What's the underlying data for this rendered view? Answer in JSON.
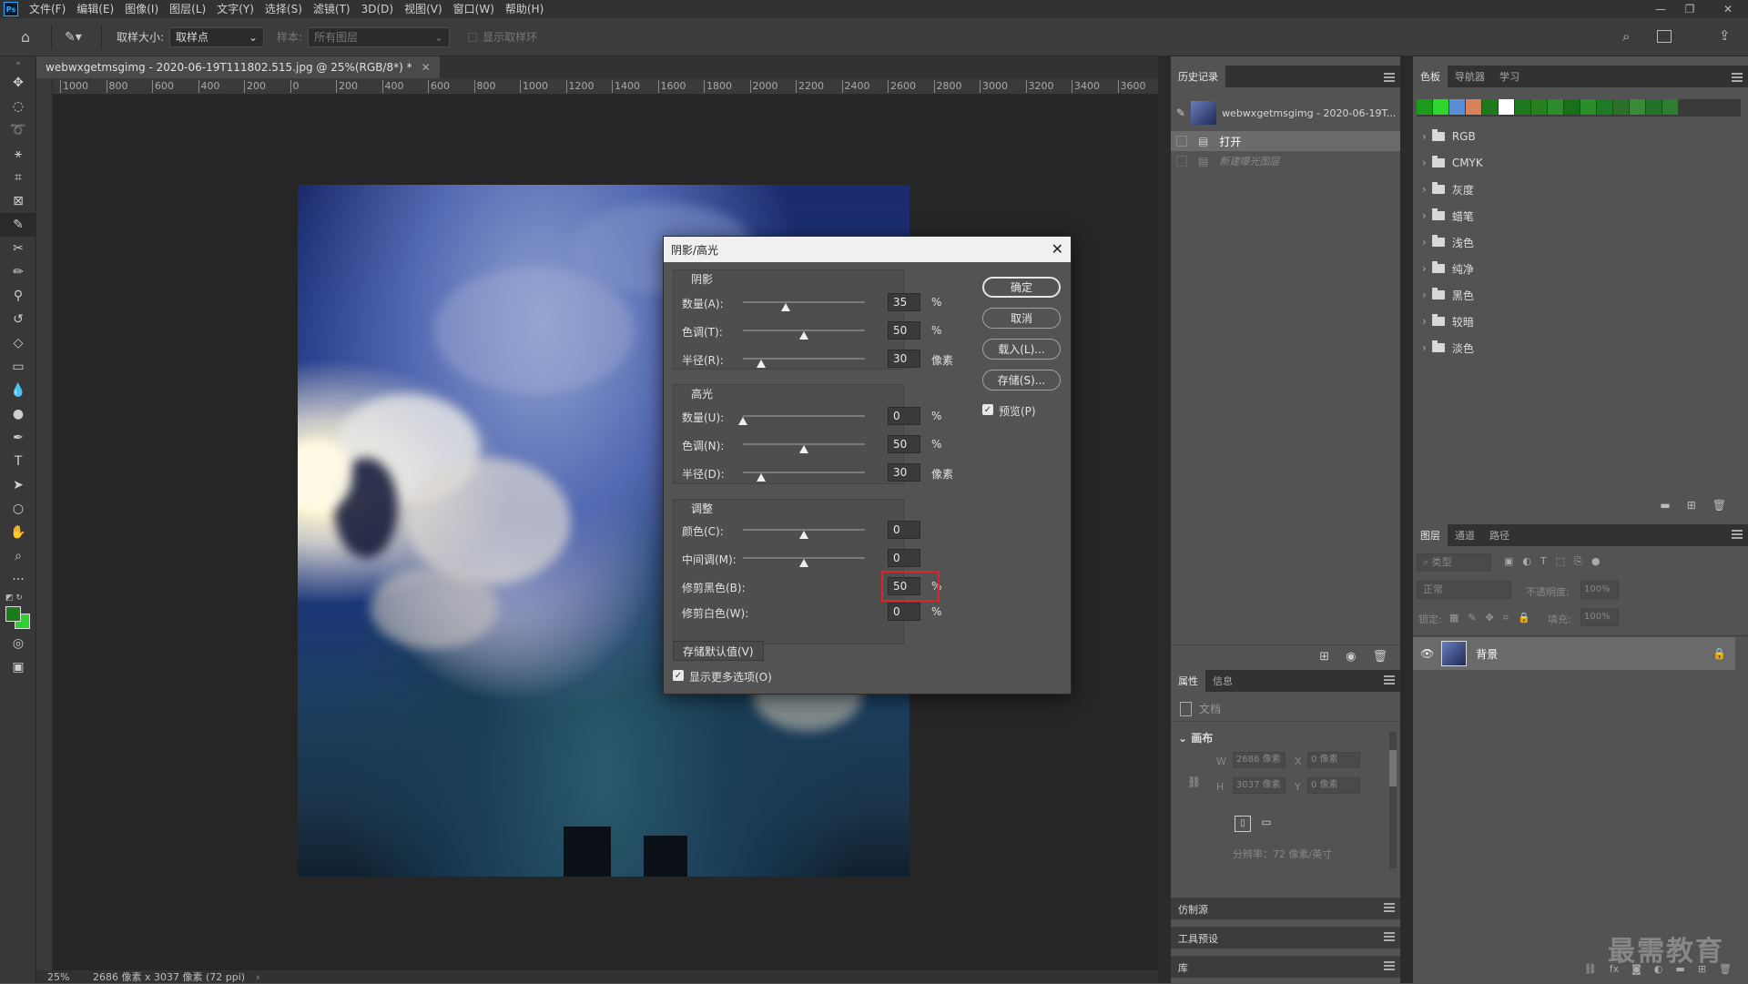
{
  "app": {
    "logo": "Ps",
    "menus": [
      "文件(F)",
      "编辑(E)",
      "图像(I)",
      "图层(L)",
      "文字(Y)",
      "选择(S)",
      "滤镜(T)",
      "3D(D)",
      "视图(V)",
      "窗口(W)",
      "帮助(H)"
    ]
  },
  "options": {
    "sample_size_label": "取样大小:",
    "sample_size_value": "取样点",
    "sample_label": "样本:",
    "sample_value": "所有图层",
    "show_ring": "显示取样环"
  },
  "document": {
    "tab_title": "webwxgetmsgimg - 2020-06-19T111802.515.jpg @ 25%(RGB/8*) *",
    "ruler_ticks": [
      "1000",
      "800",
      "600",
      "400",
      "200",
      "0",
      "200",
      "400",
      "600",
      "800",
      "1000",
      "1200",
      "1400",
      "1600",
      "1800",
      "2000",
      "2200",
      "2400",
      "2600",
      "2800",
      "3000",
      "3200",
      "3400",
      "3600"
    ],
    "zoom": "25%",
    "info": "2686 像素 x 3037 像素 (72 ppi)"
  },
  "history": {
    "tabs": [
      "历史记录"
    ],
    "snapshot": "webwxgetmsgimg - 2020-06-19T...",
    "items": [
      "打开",
      "新建曝光图层"
    ]
  },
  "swatches": {
    "tabs": [
      "色板",
      "导航器",
      "学习"
    ],
    "colors": [
      "#1a9c1a",
      "#2fd62f",
      "#5a8fd6",
      "#d6825a",
      "#1b7a1b",
      "#ffffff",
      "#1e7a1e",
      "#27801f",
      "#2d8a2d",
      "#1b6e1b",
      "#2a8f2a",
      "#1f7a26",
      "#2c6f2c",
      "#3a8a3a",
      "#22722a",
      "#2e7d32"
    ],
    "folders": [
      "RGB",
      "CMYK",
      "灰度",
      "蜡笔",
      "浅色",
      "纯净",
      "黑色",
      "较暗",
      "淡色"
    ]
  },
  "properties": {
    "tabs": [
      "属性",
      "信息"
    ],
    "doc_label": "文档",
    "canvas_label": "画布",
    "w_label": "W",
    "w_value": "2686 像素",
    "h_label": "H",
    "h_value": "3037 像素",
    "x_label": "X",
    "x_value": "0 像素",
    "y_label": "Y",
    "y_value": "0 像素",
    "resolution": "分辨率：72 像素/英寸"
  },
  "collapsed_panels": [
    "仿制源",
    "工具预设",
    "库"
  ],
  "layers": {
    "tabs": [
      "图层",
      "通道",
      "路径"
    ],
    "filter_placeholder": "类型",
    "blend_mode": "正常",
    "opacity_label": "不透明度:",
    "opacity_value": "100%",
    "lock_label": "锁定:",
    "fill_label": "填充:",
    "fill_value": "100%",
    "layer_name": "背景"
  },
  "dialog": {
    "title": "阴影/高光",
    "shadows": {
      "title": "阴影",
      "rows": [
        {
          "label": "数量(A):",
          "value": "35",
          "unit": "%",
          "pos": 0.35
        },
        {
          "label": "色调(T):",
          "value": "50",
          "unit": "%",
          "pos": 0.5
        },
        {
          "label": "半径(R):",
          "value": "30",
          "unit": "像素",
          "pos": 0.15
        }
      ]
    },
    "highlights": {
      "title": "高光",
      "rows": [
        {
          "label": "数量(U):",
          "value": "0",
          "unit": "%",
          "pos": 0.0
        },
        {
          "label": "色调(N):",
          "value": "50",
          "unit": "%",
          "pos": 0.5
        },
        {
          "label": "半径(D):",
          "value": "30",
          "unit": "像素",
          "pos": 0.15
        }
      ]
    },
    "adjust": {
      "title": "调整",
      "rows": [
        {
          "label": "颜色(C):",
          "value": "0",
          "unit": "",
          "pos": 0.5
        },
        {
          "label": "中间调(M):",
          "value": "0",
          "unit": "",
          "pos": 0.5
        }
      ],
      "clip_black_label": "修剪黑色(B):",
      "clip_black_value": "50",
      "clip_white_label": "修剪白色(W):",
      "clip_white_value": "0",
      "unit": "%"
    },
    "buttons": {
      "ok": "确定",
      "cancel": "取消",
      "load": "载入(L)...",
      "save": "存储(S)...",
      "preview": "预览(P)",
      "save_default": "存储默认值(V)",
      "show_more": "显示更多选项(O)"
    }
  },
  "watermark": "最需教育"
}
